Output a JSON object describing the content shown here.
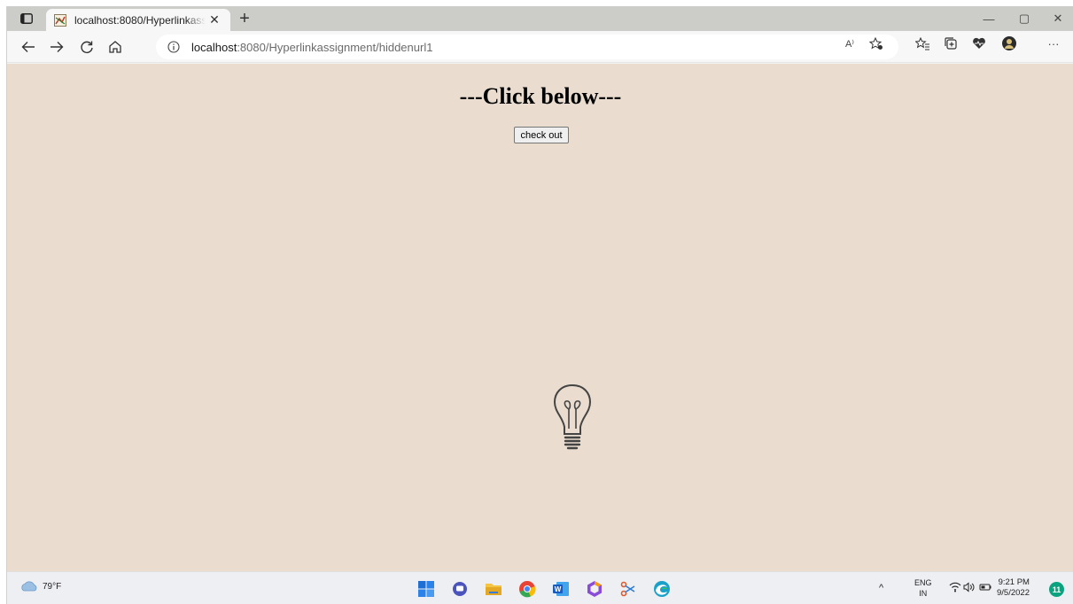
{
  "browser": {
    "tab": {
      "title": "localhost:8080/Hyperlinkassignment/hiddenurl1",
      "close": "✕"
    },
    "new_tab": "+",
    "window_controls": {
      "minimize": "—",
      "maximize": "▢",
      "close": "✕"
    },
    "address": {
      "host": "localhost",
      "path": ":8080/Hyperlinkassignment/hiddenurl1"
    },
    "more_label": "···",
    "read_aloud_label": "A⁾"
  },
  "page": {
    "heading": "---Click below---",
    "button_label": "check out"
  },
  "taskbar": {
    "weather_temp": "79°F",
    "language": "ENG",
    "region": "IN",
    "time": "9:21 PM",
    "date": "9/5/2022",
    "notification_count": "11",
    "colors": {
      "page_background": "#eaddcf",
      "notification": "#0aa37f"
    }
  }
}
